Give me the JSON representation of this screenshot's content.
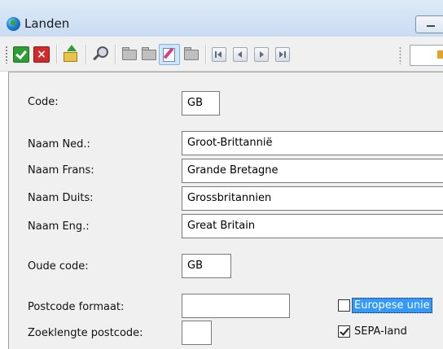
{
  "window": {
    "title": "Landen"
  },
  "toolbar": {
    "items": [
      "confirm-icon",
      "cancel-icon",
      "export-icon",
      "search-icon",
      "folder-icon",
      "copy-icon",
      "edit-icon",
      "folder-open-icon",
      "first-icon",
      "prev-icon",
      "next-icon",
      "last-icon"
    ]
  },
  "form": {
    "code_label": "Code:",
    "code_value": "GB",
    "naam_ned_label": "Naam Ned.:",
    "naam_ned_value": "Groot-Brittannië",
    "naam_frans_label": "Naam Frans:",
    "naam_frans_value": "Grande Bretagne",
    "naam_duits_label": "Naam Duits:",
    "naam_duits_value": "Grossbritannien",
    "naam_eng_label": "Naam Eng.:",
    "naam_eng_value": "Great Britain",
    "oude_code_label": "Oude code:",
    "oude_code_value": "GB",
    "postcode_formaat_label": "Postcode formaat:",
    "postcode_formaat_value": "",
    "zoeklengte_label": "Zoeklengte postcode:",
    "zoeklengte_value": "",
    "europese_unie_label": "Europese unie",
    "europese_unie_checked": false,
    "sepa_label": "SEPA-land",
    "sepa_checked": true
  }
}
